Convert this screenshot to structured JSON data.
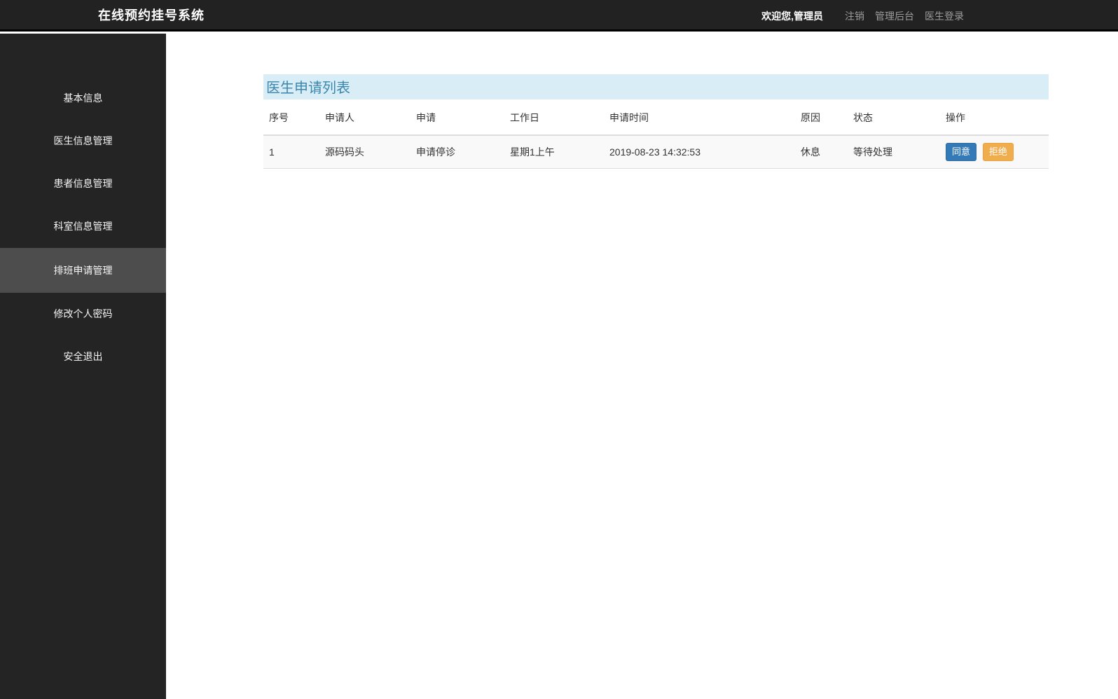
{
  "app": {
    "title": "在线预约挂号系统"
  },
  "header": {
    "welcome": "欢迎您,管理员",
    "links": [
      {
        "label": "注销"
      },
      {
        "label": "管理后台"
      },
      {
        "label": "医生登录"
      }
    ]
  },
  "sidebar": {
    "items": [
      {
        "label": "基本信息",
        "active": false
      },
      {
        "label": "医生信息管理",
        "active": false
      },
      {
        "label": "患者信息管理",
        "active": false
      },
      {
        "label": "科室信息管理",
        "active": false
      },
      {
        "label": "排班申请管理",
        "active": true
      },
      {
        "label": "修改个人密码",
        "active": false
      },
      {
        "label": "安全退出",
        "active": false
      }
    ]
  },
  "main": {
    "panel_title": "医生申请列表",
    "table": {
      "columns": [
        "序号",
        "申请人",
        "申请",
        "工作日",
        "申请时间",
        "原因",
        "状态",
        "操作"
      ],
      "rows": [
        {
          "no": "1",
          "applicant": "源码码头",
          "application": "申请停诊",
          "workday": "星期1上午",
          "time": "2019-08-23 14:32:53",
          "reason": "休息",
          "status": "等待处理",
          "actions": {
            "agree": "同意",
            "reject": "拒绝"
          }
        }
      ]
    }
  },
  "colors": {
    "agree_button": "#337ab7",
    "reject_button": "#f0ad4e",
    "panel_title_bg": "#d9edf7",
    "panel_title_text": "#3a87ad",
    "header_bg": "#222222",
    "sidebar_bg": "#242424",
    "sidebar_active_bg": "#4d4d4d"
  }
}
